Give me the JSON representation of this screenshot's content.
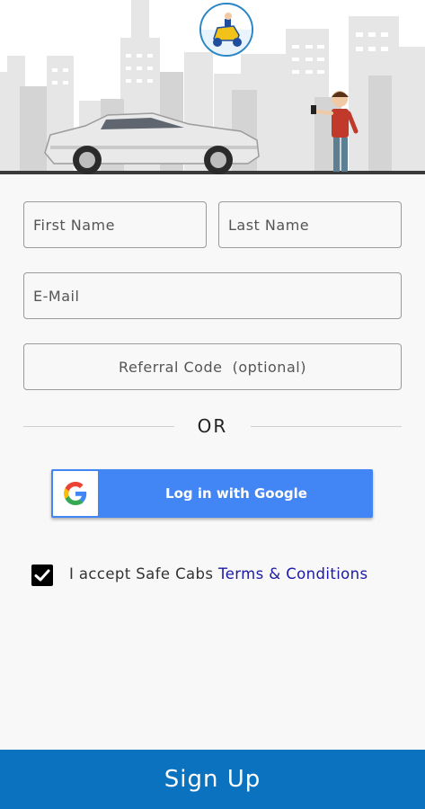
{
  "header": {
    "illustration": "city-car-person-icon",
    "logo": "scooter-logo-icon"
  },
  "form": {
    "first_name_placeholder": "First Name",
    "last_name_placeholder": "Last Name",
    "email_placeholder": "E-Mail",
    "referral_placeholder": "Referral Code  (optional)"
  },
  "divider": {
    "label": "OR"
  },
  "google_login": {
    "label": "Log in with Google",
    "icon": "google-g-icon"
  },
  "terms": {
    "checked": true,
    "prefix": "I accept Safe Cabs ",
    "link_label": "Terms & Conditions"
  },
  "signup": {
    "label": "Sign Up"
  },
  "colors": {
    "primary": "#0b72bf",
    "google_blue": "#4285f4",
    "link": "#1a1aa6"
  }
}
